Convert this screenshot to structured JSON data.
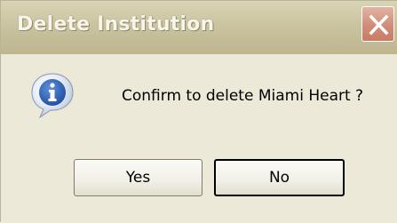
{
  "dialog": {
    "title": "Delete Institution",
    "message": "Confirm to delete Miami Heart ?",
    "close_icon": "close-icon",
    "info_icon": "information-icon",
    "buttons": {
      "yes_label": "Yes",
      "no_label": "No"
    },
    "colors": {
      "close_button": "#d08d78",
      "info_icon_blue": "#2f63b8",
      "dialog_background": "#ece9d8"
    }
  }
}
